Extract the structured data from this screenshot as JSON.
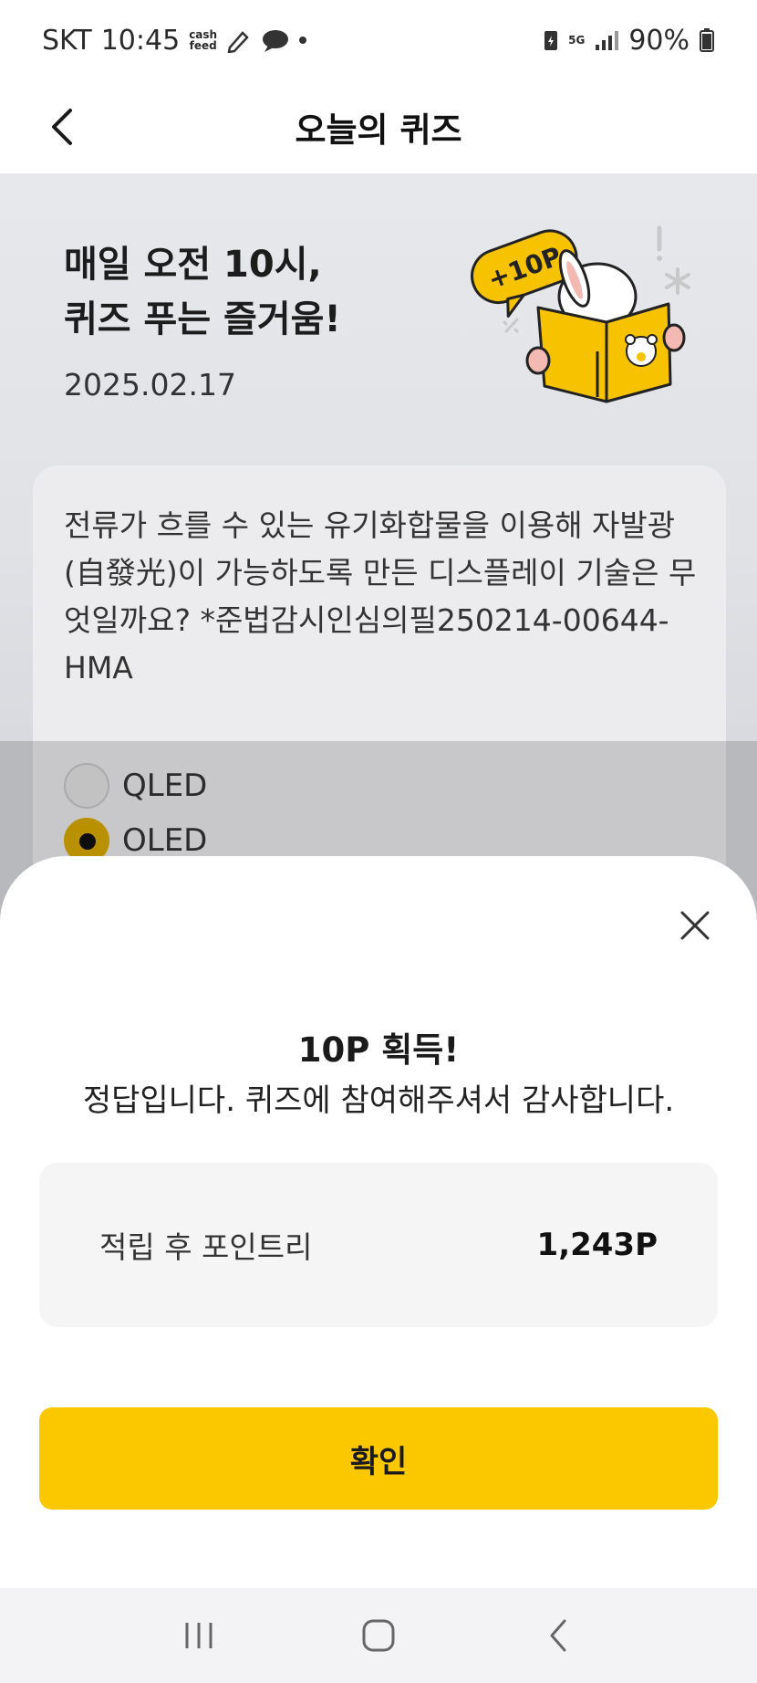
{
  "status_bar": {
    "carrier": "SKT",
    "time": "10:45",
    "app_badge_top": "cash",
    "app_badge_bottom": "feed",
    "network": "5G",
    "battery": "90%"
  },
  "header": {
    "title": "오늘의 퀴즈"
  },
  "hero": {
    "title": "매일 오전 10시,\n퀴즈 푸는 즐거움!",
    "date": "2025.02.17",
    "badge": "+10P"
  },
  "quiz": {
    "question": "전류가 흐를 수 있는 유기화합물을 이용해 자발광(自發光)이 가능하도록 만든 디스플레이 기술은 무엇일까요? *준법감시인심의필250214-00644-HMA",
    "options": [
      {
        "label": "QLED",
        "selected": false
      },
      {
        "label": "OLED",
        "selected": true
      }
    ]
  },
  "sheet": {
    "title": "10P 획득!",
    "message": "정답입니다. 퀴즈에 참여해주셔서 감사합니다.",
    "points_label": "적립 후 포인트리",
    "points_value": "1,243P",
    "confirm_label": "확인"
  },
  "colors": {
    "accent": "#fbc800",
    "radio_selected": "#d9aa00"
  }
}
